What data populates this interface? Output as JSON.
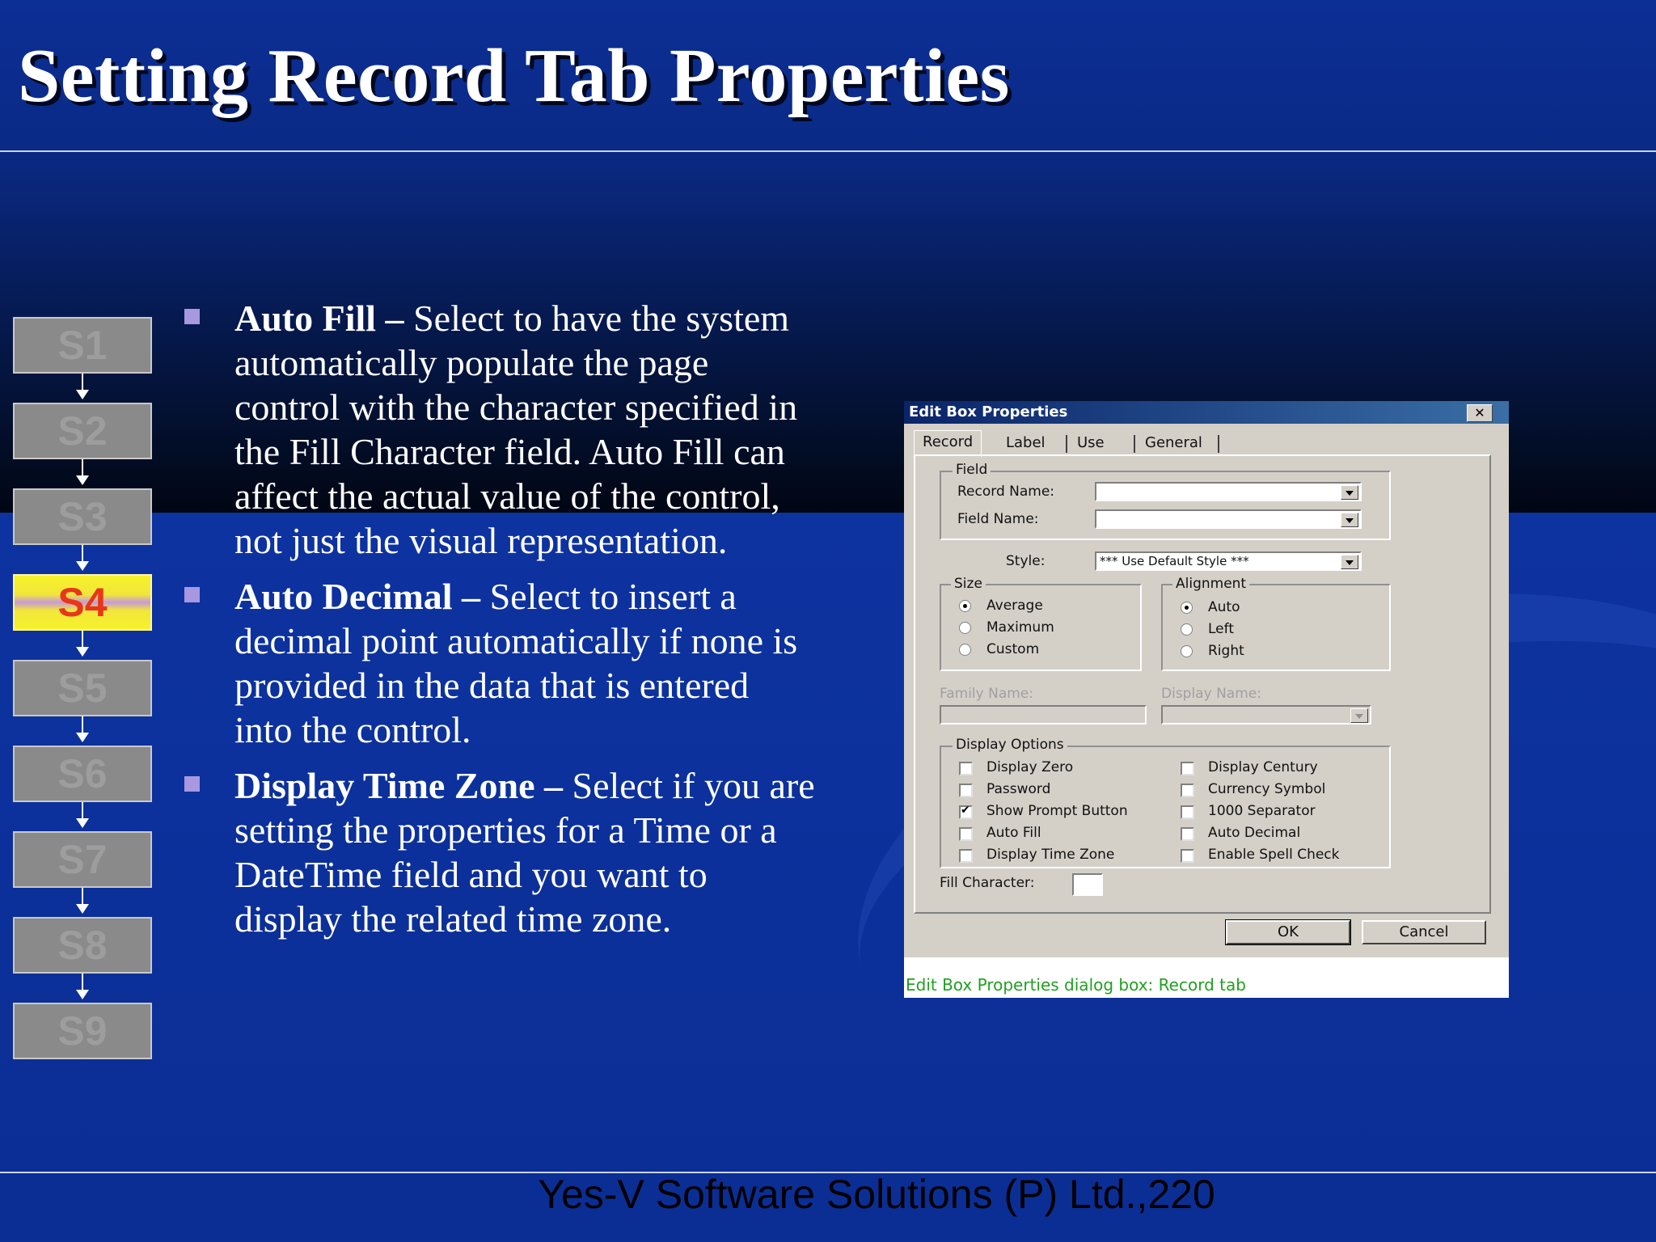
{
  "slide": {
    "title": "Setting Record Tab Properties",
    "footer": "Yes-V Software Solutions (P) Ltd.,220"
  },
  "steps": [
    "S1",
    "S2",
    "S3",
    "S4",
    "S5",
    "S6",
    "S7",
    "S8",
    "S9"
  ],
  "active_step": "S4",
  "bullets": [
    {
      "term": "Auto Fill –",
      "text": " Select to have the system automatically populate the page control with the character specified in the Fill Character field. Auto Fill can affect the actual value of the control, not just the visual representation."
    },
    {
      "term": "Auto Decimal –",
      "text": " Select to insert a decimal point automatically if none is provided in the data that is entered into the control."
    },
    {
      "term": "Display Time Zone –",
      "text": " Select if you are setting the properties for a Time or a DateTime field and you want to display the related time zone."
    }
  ],
  "dialog": {
    "title": "Edit Box Properties",
    "close": "✕",
    "tabs": [
      "Record",
      "Label",
      "Use",
      "General"
    ],
    "field_group": "Field",
    "record_name_label": "Record Name:",
    "field_name_label": "Field Name:",
    "record_name_value": "",
    "field_name_value": "",
    "style_label": "Style:",
    "style_value": "*** Use Default Style ***",
    "size_group": "Size",
    "size_options": [
      "Average",
      "Maximum",
      "Custom"
    ],
    "alignment_group": "Alignment",
    "alignment_options": [
      "Auto",
      "Left",
      "Right"
    ],
    "family_name_label": "Family Name:",
    "display_name_label": "Display Name:",
    "display_options_group": "Display Options",
    "options_left": [
      {
        "label": "Display Zero",
        "checked": false
      },
      {
        "label": "Password",
        "checked": false
      },
      {
        "label": "Show Prompt Button",
        "checked": true
      },
      {
        "label": "Auto Fill",
        "checked": false
      },
      {
        "label": "Display Time Zone",
        "checked": false
      }
    ],
    "options_right": [
      {
        "label": "Display Century",
        "checked": false
      },
      {
        "label": "Currency Symbol",
        "checked": false
      },
      {
        "label": "1000 Separator",
        "checked": false
      },
      {
        "label": "Auto Decimal",
        "checked": false
      },
      {
        "label": "Enable Spell Check",
        "checked": false
      }
    ],
    "fill_character_label": "Fill Character:",
    "fill_character_value": "",
    "ok": "OK",
    "cancel": "Cancel"
  },
  "caption": "Edit Box Properties dialog box: Record tab",
  "colors": {
    "accent_bullet": "#a898e0",
    "active_step_text": "#e8361b",
    "caption": "#22a022"
  }
}
